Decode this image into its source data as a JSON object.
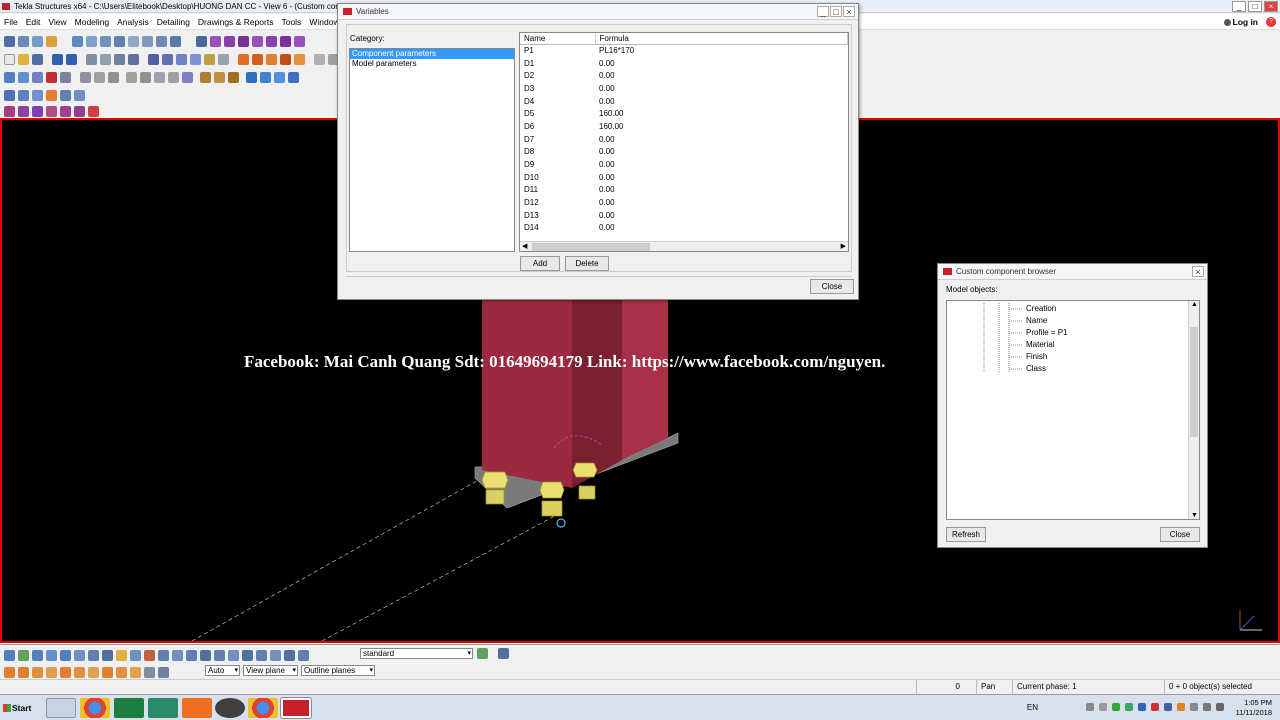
{
  "app": {
    "title": "Tekla Structures x64 - C:\\Users\\Elitebook\\Desktop\\HUONG DAN CC - View 6 - (Custom com",
    "window_controls": [
      "_",
      "□",
      "×"
    ]
  },
  "menu": {
    "items": [
      "File",
      "Edit",
      "View",
      "Modeling",
      "Analysis",
      "Detailing",
      "Drawings & Reports",
      "Tools",
      "Window"
    ],
    "login": "Log in",
    "help": "?"
  },
  "watermark": "Facebook: Mai Canh Quang  Sdt: 01649694179 Link: https://www.facebook.com/nguyen.",
  "variables_dialog": {
    "title": "Variables",
    "category_label": "Category:",
    "categories": [
      "Component parameters",
      "Model parameters"
    ],
    "selected_category": "Component parameters",
    "columns": [
      "Name",
      "Formula"
    ],
    "rows": [
      {
        "name": "P1",
        "formula": "PL16*170"
      },
      {
        "name": "D1",
        "formula": "0.00"
      },
      {
        "name": "D2",
        "formula": "0.00"
      },
      {
        "name": "D3",
        "formula": "0.00"
      },
      {
        "name": "D4",
        "formula": "0.00"
      },
      {
        "name": "D5",
        "formula": "160.00"
      },
      {
        "name": "D6",
        "formula": "160.00"
      },
      {
        "name": "D7",
        "formula": "0.00"
      },
      {
        "name": "D8",
        "formula": "0.00"
      },
      {
        "name": "D9",
        "formula": "0.00"
      },
      {
        "name": "D10",
        "formula": "0.00"
      },
      {
        "name": "D11",
        "formula": "0.00"
      },
      {
        "name": "D12",
        "formula": "0.00"
      },
      {
        "name": "D13",
        "formula": "0.00"
      },
      {
        "name": "D14",
        "formula": "0.00"
      }
    ],
    "add_label": "Add",
    "delete_label": "Delete",
    "close_label": "Close"
  },
  "browser_dialog": {
    "title": "Custom component browser",
    "model_objects_label": "Model objects:",
    "tree_items": [
      "Creation",
      "Name",
      "Profile = P1",
      "Material",
      "Finish",
      "Class"
    ],
    "refresh_label": "Refresh",
    "close_label": "Close"
  },
  "bottom_toolbar": {
    "view_select": "standard",
    "auto_select": "Auto",
    "plane_select": "View plane",
    "outline_select": "Outline planes"
  },
  "status": {
    "value": "0",
    "mode": "Pan",
    "phase": "Current phase: 1",
    "selection": "0 + 0 object(s) selected"
  },
  "taskbar": {
    "start_label": "Start",
    "language": "EN",
    "time": "1:05 PM",
    "date": "11/11/2018"
  },
  "colors": {
    "viewport_border": "#e00000",
    "column": "#9b2a40",
    "bolt": "#e8e070",
    "selection": "#3399ff"
  }
}
